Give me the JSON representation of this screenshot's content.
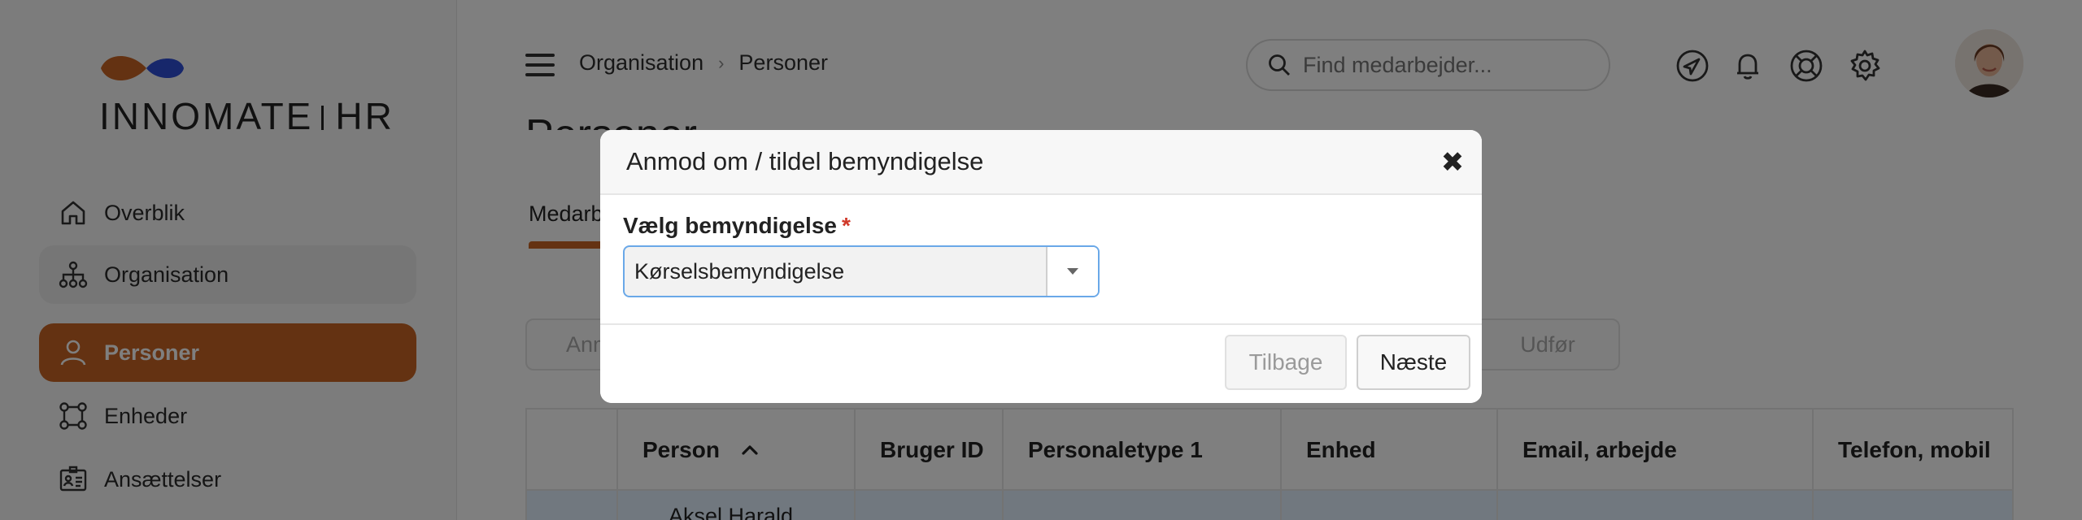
{
  "brand": {
    "name_light": "INNO",
    "name_bold": "MATE",
    "suffix": "HR",
    "colors": {
      "orange": "#c96524",
      "blue": "#2e4fd6"
    }
  },
  "sidebar": {
    "items": [
      {
        "label": "Overblik",
        "icon": "home-icon",
        "state": "normal"
      },
      {
        "label": "Organisation",
        "icon": "org-chart-icon",
        "state": "hover"
      },
      {
        "label": "Personer",
        "icon": "person-icon",
        "state": "active"
      },
      {
        "label": "Enheder",
        "icon": "units-icon",
        "state": "normal"
      },
      {
        "label": "Ansættelser",
        "icon": "id-card-icon",
        "state": "normal"
      }
    ]
  },
  "header": {
    "breadcrumb": [
      "Organisation",
      "Personer"
    ],
    "search_placeholder": "Find medarbejder...",
    "icons": [
      "navigation-icon",
      "bell-icon",
      "lifebuoy-icon",
      "gear-icon"
    ]
  },
  "page": {
    "title": "Personer",
    "first_tab": "Medarbejdere",
    "action_left": "Anmod",
    "action_right": "Udfør"
  },
  "table": {
    "columns": [
      "",
      "Person",
      "Bruger ID",
      "Personaletype 1",
      "Enhed",
      "Email, arbejde",
      "Telefon, mobil"
    ],
    "sort_column": "Person",
    "sort_direction": "ascending",
    "first_row_person": "Aksel Harald"
  },
  "modal": {
    "title": "Anmod om / tildel bemyndigelse",
    "field_label": "Vælg bemyndigelse",
    "required_mark": "*",
    "selected_value": "Kørselsbemyndigelse",
    "back_label": "Tilbage",
    "next_label": "Næste"
  }
}
